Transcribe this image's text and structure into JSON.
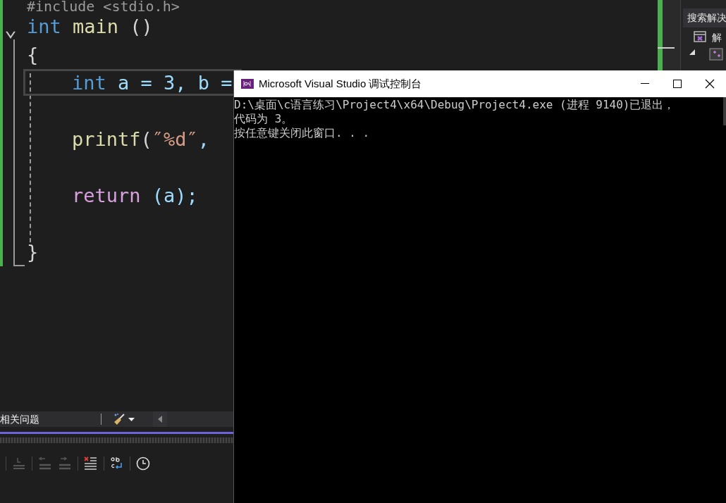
{
  "editor": {
    "lines": [
      {
        "kind": "include",
        "text": "#include <stdio.h>"
      },
      {
        "kind": "func",
        "fold": "⌄",
        "type": "int",
        "name": "main",
        "rest": " ()"
      },
      {
        "kind": "brace",
        "text": "{"
      },
      {
        "kind": "decl",
        "type": "int",
        "rest": " a = 3, b =",
        "current": true
      },
      {
        "kind": "blank"
      },
      {
        "kind": "call",
        "name": "printf",
        "open": "(",
        "str": "″%d″",
        "rest": ","
      },
      {
        "kind": "blank"
      },
      {
        "kind": "ret",
        "keyword": "return",
        "rest": " (a);"
      },
      {
        "kind": "blank"
      },
      {
        "kind": "brace",
        "text": "}"
      }
    ]
  },
  "solution_panel": {
    "search_placeholder": "搜索解决",
    "item": "解"
  },
  "error_list": {
    "label": "相关问题"
  },
  "console": {
    "title": "Microsoft Visual Studio 调试控制台",
    "lines": [
      "D:\\桌面\\c语言练习\\Project4\\x64\\Debug\\Project4.exe (进程 9140)已退出，",
      "代码为 3。",
      "按任意键关闭此窗口. . ."
    ]
  }
}
